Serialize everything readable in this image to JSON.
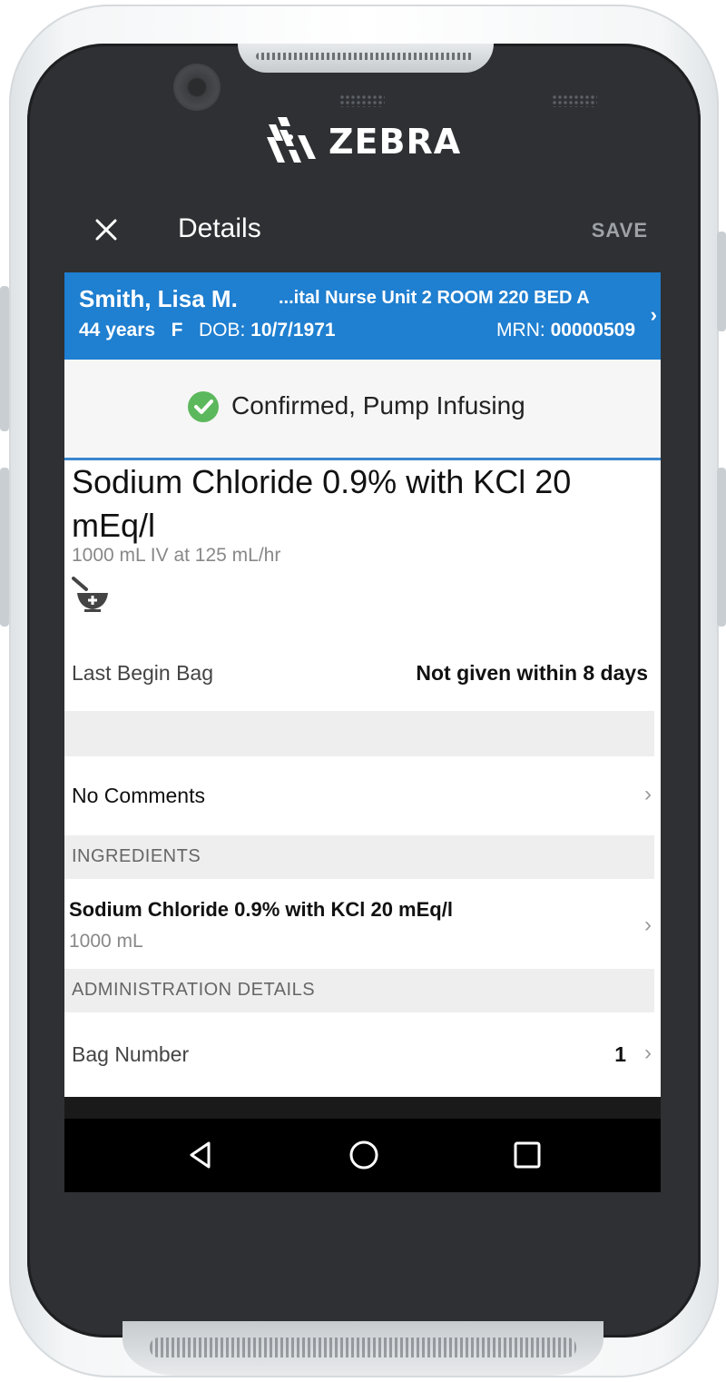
{
  "device": {
    "brand": "ZEBRA"
  },
  "appbar": {
    "title": "Details",
    "save_label": "SAVE"
  },
  "patient": {
    "name": "Smith, Lisa M.",
    "location": "...ital Nurse Unit 2 ROOM 220 BED A",
    "age": "44 years",
    "sex": "F",
    "dob_label": "DOB:",
    "dob": "10/7/1971",
    "mrn_label": "MRN:",
    "mrn": "00000509"
  },
  "status": {
    "text": "Confirmed, Pump Infusing",
    "color": "#5cb85c"
  },
  "medication": {
    "name": "Sodium Chloride 0.9% with KCl 20 mEq/l",
    "dose": "1000 mL IV at 125 mL/hr",
    "icon": "mortar-pestle-add-icon"
  },
  "last_begin_bag": {
    "label": "Last Begin Bag",
    "value": "Not given within 8 days"
  },
  "comments": {
    "label": "No Comments"
  },
  "ingredients": {
    "header": "INGREDIENTS",
    "items": [
      {
        "name": "Sodium Chloride 0.9% with KCl 20 mEq/l",
        "amount": "1000 mL"
      }
    ]
  },
  "administration": {
    "header": "ADMINISTRATION DETAILS",
    "bag_number_label": "Bag Number",
    "bag_number_value": "1"
  },
  "colors": {
    "accent": "#1f7fd0",
    "appbar": "#2e3033"
  }
}
